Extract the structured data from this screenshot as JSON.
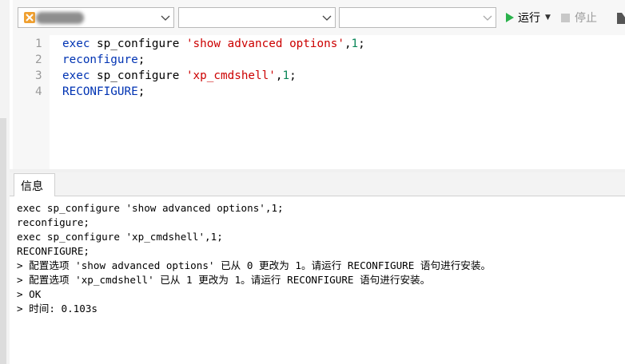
{
  "toolbar": {
    "connection_value": "",
    "database_value": "",
    "schema_value": "",
    "run_label": "运行",
    "stop_label": "停止"
  },
  "editor": {
    "lines": [
      {
        "num": "1",
        "parts": [
          {
            "t": "exec",
            "c": "kw"
          },
          {
            "t": " sp_configure ",
            "c": ""
          },
          {
            "t": "'show advanced options'",
            "c": "str"
          },
          {
            "t": ",",
            "c": ""
          },
          {
            "t": "1",
            "c": "num"
          },
          {
            "t": ";",
            "c": ""
          }
        ]
      },
      {
        "num": "2",
        "parts": [
          {
            "t": "reconfigure",
            "c": "kw"
          },
          {
            "t": ";",
            "c": ""
          }
        ]
      },
      {
        "num": "3",
        "parts": [
          {
            "t": "exec",
            "c": "kw"
          },
          {
            "t": " sp_configure ",
            "c": ""
          },
          {
            "t": "'xp_cmdshell'",
            "c": "str"
          },
          {
            "t": ",",
            "c": ""
          },
          {
            "t": "1",
            "c": "num"
          },
          {
            "t": ";",
            "c": ""
          }
        ]
      },
      {
        "num": "4",
        "parts": [
          {
            "t": "RECONFIGURE",
            "c": "kw"
          },
          {
            "t": ";",
            "c": ""
          }
        ]
      }
    ]
  },
  "results": {
    "tab_label": "信息",
    "lines": [
      "exec sp_configure 'show advanced options',1;",
      "reconfigure;",
      "exec sp_configure 'xp_cmdshell',1;",
      "RECONFIGURE;",
      "> 配置选项 'show advanced options' 已从 0 更改为 1。请运行 RECONFIGURE 语句进行安装。",
      "> 配置选项 'xp_cmdshell' 已从 1 更改为 1。请运行 RECONFIGURE 语句进行安装。",
      "> OK",
      "> 时间: 0.103s"
    ]
  },
  "colors": {
    "keyword": "#0033b3",
    "string": "#cc0000",
    "number": "#098658",
    "run_green": "#2bb24c"
  }
}
